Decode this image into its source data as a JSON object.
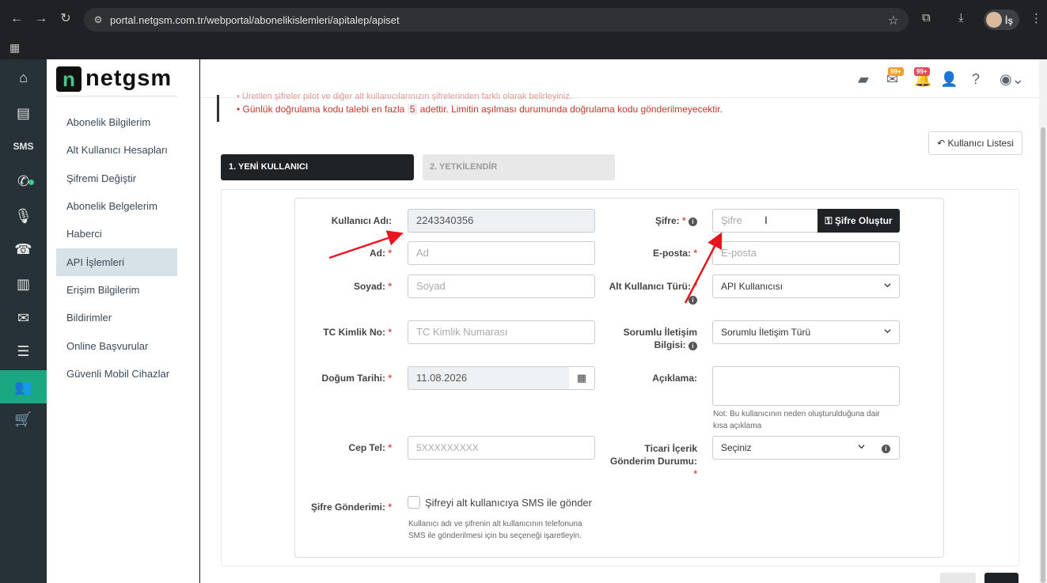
{
  "browser": {
    "url": "portal.netgsm.com.tr/webportal/abonelikislemleri/apitalep/apiset",
    "profile_label": "İş"
  },
  "logo": {
    "mark": "n",
    "text": "netgsm"
  },
  "sidebar": {
    "items": [
      {
        "label": "Abonelik Bilgilerim"
      },
      {
        "label": "Alt Kullanıcı Hesapları"
      },
      {
        "label": "Şifremi Değiştir"
      },
      {
        "label": "Abonelik Belgelerim"
      },
      {
        "label": "Haberci"
      },
      {
        "label": "API İşlemleri"
      },
      {
        "label": "Erişim Bilgilerim"
      },
      {
        "label": "Bildirimler"
      },
      {
        "label": "Online Başvurular"
      },
      {
        "label": "Güvenli Mobil Cihazlar"
      }
    ]
  },
  "topbar": {
    "mail_badge": "99+",
    "notif_badge": "99+"
  },
  "notice": {
    "faded_line": "Üretilen şifreler pilot ve diğer alt kullanıcılarınızın şifrelerinden farklı olarak belirleyiniz.",
    "line_prefix": "Günlük doğrulama kodu talebi en fazla",
    "line_number": "5",
    "line_suffix": "adettir. Limitin aşılması durumunda doğrulama kodu gönderilmeyecektir."
  },
  "buttons": {
    "user_list": "Kullanıcı Listesi",
    "create_password": "Şifre Oluştur"
  },
  "steps": {
    "step1": "1. YENİ KULLANICI",
    "step2": "2. YETKİLENDİR"
  },
  "form": {
    "username_label": "Kullanıcı Adı:",
    "username_value": "2243340356",
    "name_label": "Ad:",
    "name_placeholder": "Ad",
    "surname_label": "Soyad:",
    "surname_placeholder": "Soyad",
    "tc_label": "TC Kimlik No:",
    "tc_placeholder": "TC Kimlik Numarası",
    "birth_label": "Doğum Tarihi:",
    "birth_value": "11.08.2026",
    "phone_label": "Cep Tel:",
    "phone_placeholder": "5XXXXXXXXX",
    "pw_send_label": "Şifre Gönderimi:",
    "pw_send_checkbox": "Şifreyi alt kullanıcıya SMS ile gönder",
    "pw_send_note_1": "Kullanıcı adı ve şifrenin alt kullanıcının telefonuna",
    "pw_send_note_2": "SMS ile gönderilmesi için bu seçeneği işaretleyin.",
    "password_label": "Şifre:",
    "password_placeholder": "Şifre",
    "email_label": "E-posta:",
    "email_placeholder": "E-posta",
    "subuser_type_label": "Alt Kullanıcı Türü:",
    "subuser_type_value": "API Kullanıcısı",
    "contact_label_1": "Sorumlu İletişim",
    "contact_label_2": "Bilgisi:",
    "contact_value": "Sorumlu İletişim Türü",
    "desc_label": "Açıklama:",
    "desc_note_1": "Not: Bu kullanıcının neden oluşturulduğuna dair",
    "desc_note_2": "kısa açıklama",
    "commercial_label_1": "Ticari İçerik",
    "commercial_label_2": "Gönderim Durumu:",
    "commercial_value": "Seçiniz",
    "required_mark": "*"
  },
  "colors": {
    "rail_bg": "#263238",
    "rail_active": "#1aa882",
    "dark_button": "#1f2326",
    "annotation_arrow": "#e8141e"
  }
}
